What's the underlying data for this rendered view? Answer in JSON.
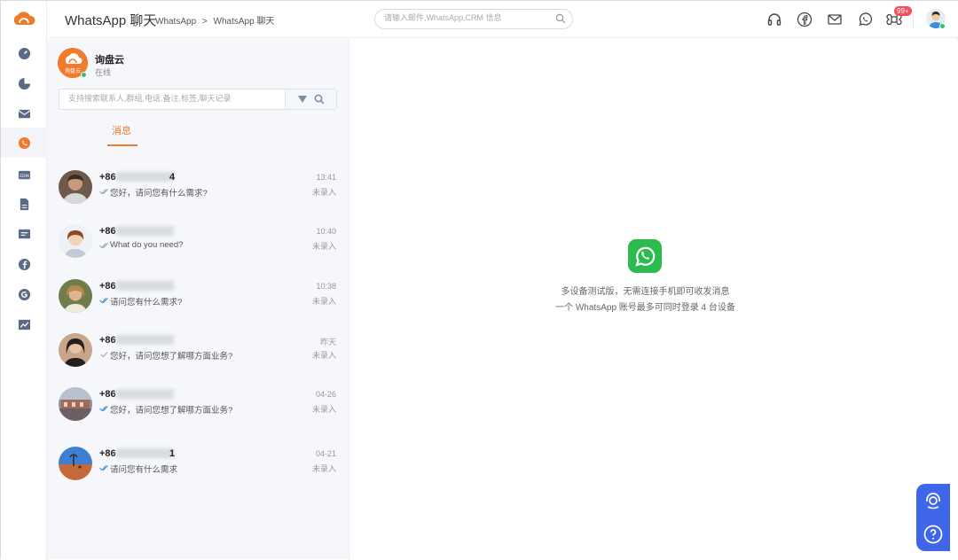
{
  "header": {
    "title": "WhatsApp 聊天",
    "breadcrumb": [
      "WhatsApp",
      ">",
      "WhatsApp 聊天"
    ],
    "search_placeholder": "请输入邮件,WhatsApp,CRM 信息",
    "notification_badge": "99+"
  },
  "sidebar": {
    "items": [
      {
        "icon": "dashboard-icon"
      },
      {
        "icon": "pie-chart-icon"
      },
      {
        "icon": "mail-icon"
      },
      {
        "icon": "whatsapp-icon",
        "active": true
      },
      {
        "icon": "edm-icon",
        "label": "EDM"
      },
      {
        "icon": "document-icon"
      },
      {
        "icon": "message-board-icon"
      },
      {
        "icon": "facebook-icon"
      },
      {
        "icon": "google-icon"
      },
      {
        "icon": "analytics-icon"
      }
    ]
  },
  "account": {
    "name": "询盘云",
    "status": "在线",
    "avatar_text": "询盘云"
  },
  "chat_search": {
    "placeholder": "支持搜索联系人,群组,电话,备注,标签,聊天记录"
  },
  "tabs": {
    "messages": "消息"
  },
  "conversations": [
    {
      "phone": "+86",
      "tail": "4",
      "preview": "您好，请问您有什么需求?",
      "time": "13:41",
      "status": "未录入",
      "read": false
    },
    {
      "phone": "+86",
      "tail": "",
      "preview": "What do you need?",
      "time": "10:40",
      "status": "未录入",
      "read": false
    },
    {
      "phone": "+86",
      "tail": "",
      "preview": "请问您有什么需求?",
      "time": "10:38",
      "status": "未录入",
      "read": true
    },
    {
      "phone": "+86",
      "tail": "",
      "preview": "您好，请问您想了解哪方面业务?",
      "time": "昨天",
      "status": "未录入",
      "read": false
    },
    {
      "phone": "+86",
      "tail": "",
      "preview": "您好，请问您想了解哪方面业务?",
      "time": "04-26",
      "status": "未录入",
      "read": true
    },
    {
      "phone": "+86",
      "tail": "1",
      "preview": "请问您有什么需求",
      "time": "04-21",
      "status": "未录入",
      "read": true
    }
  ],
  "empty_state": {
    "line1": "多设备测试版，无需连接手机即可收发消息",
    "line2": "一个 WhatsApp 账号最多可同时登录 4 台设备"
  },
  "colors": {
    "accent": "#f07b2b",
    "whatsapp_green": "#2dba4e",
    "read_tick": "#3e8ed0",
    "help_blue": "#3f66e8"
  }
}
